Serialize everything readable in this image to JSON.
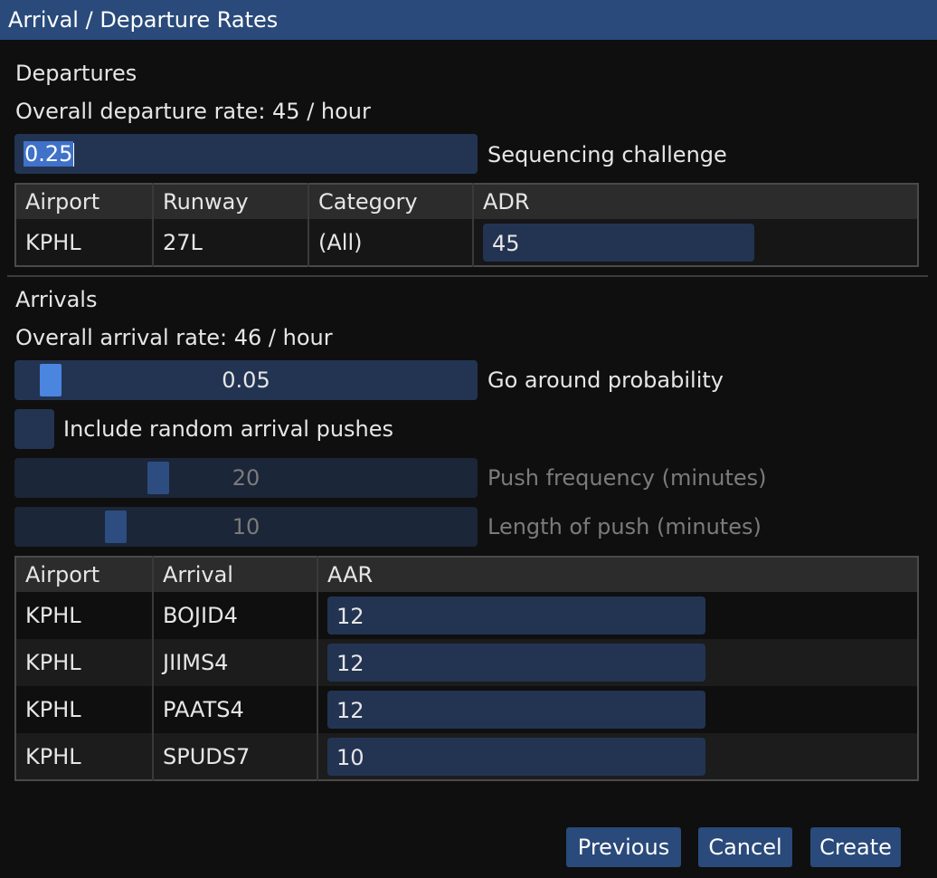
{
  "window": {
    "title": "Arrival / Departure Rates"
  },
  "departures": {
    "heading": "Departures",
    "overall_rate": "Overall departure rate: 45 / hour",
    "sequencing": {
      "value": "0.25",
      "label": "Sequencing challenge"
    },
    "table": {
      "headers": [
        "Airport",
        "Runway",
        "Category",
        "ADR"
      ],
      "rows": [
        {
          "airport": "KPHL",
          "runway": "27L",
          "category": "(All)",
          "adr": "45"
        }
      ]
    }
  },
  "arrivals": {
    "heading": "Arrivals",
    "overall_rate": "Overall arrival rate: 46 / hour",
    "go_around": {
      "value": "0.05",
      "label": "Go around probability"
    },
    "random_pushes": {
      "label": "Include random arrival pushes",
      "checked": false
    },
    "push_frequency": {
      "value": "20",
      "label": "Push frequency (minutes)"
    },
    "push_length": {
      "value": "10",
      "label": "Length of push (minutes)"
    },
    "table": {
      "headers": [
        "Airport",
        "Arrival",
        "AAR"
      ],
      "rows": [
        {
          "airport": "KPHL",
          "arrival": "BOJID4",
          "aar": "12"
        },
        {
          "airport": "KPHL",
          "arrival": "JIIMS4",
          "aar": "12"
        },
        {
          "airport": "KPHL",
          "arrival": "PAATS4",
          "aar": "12"
        },
        {
          "airport": "KPHL",
          "arrival": "SPUDS7",
          "aar": "10"
        }
      ]
    }
  },
  "buttons": {
    "previous": "Previous",
    "cancel": "Cancel",
    "create": "Create"
  },
  "colors": {
    "title_bar": "#294a7a",
    "field": "#233452",
    "slider_grab": "#4a86e0"
  }
}
